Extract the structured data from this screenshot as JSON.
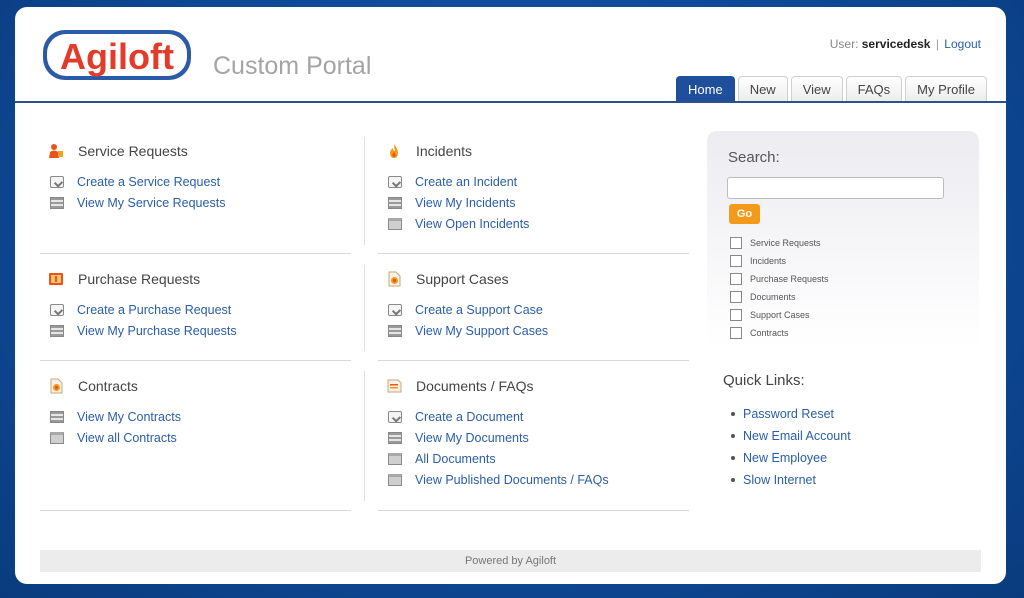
{
  "header": {
    "logo_text": "Agiloft",
    "portal_title": "Custom Portal",
    "user_label": "User:",
    "username": "servicedesk",
    "separator": "|",
    "logout": "Logout"
  },
  "tabs": [
    {
      "label": "Home",
      "active": true
    },
    {
      "label": "New"
    },
    {
      "label": "View"
    },
    {
      "label": "FAQs"
    },
    {
      "label": "My Profile"
    }
  ],
  "sections": {
    "service_requests": {
      "title": "Service Requests",
      "links": [
        "Create a Service Request",
        "View My Service Requests"
      ]
    },
    "incidents": {
      "title": "Incidents",
      "links": [
        "Create an Incident",
        "View My Incidents",
        "View Open Incidents"
      ]
    },
    "purchase_requests": {
      "title": "Purchase Requests",
      "links": [
        "Create a Purchase Request",
        "View My Purchase Requests"
      ]
    },
    "support_cases": {
      "title": "Support Cases",
      "links": [
        "Create a Support Case",
        "View My Support Cases"
      ]
    },
    "contracts": {
      "title": "Contracts",
      "links": [
        "View My Contracts",
        "View all Contracts"
      ]
    },
    "documents": {
      "title": "Documents / FAQs",
      "links": [
        "Create a Document",
        "View My Documents",
        "All Documents",
        "View Published Documents / FAQs"
      ]
    }
  },
  "search": {
    "label": "Search:",
    "value": "",
    "go": "Go",
    "filters": [
      "Service Requests",
      "Incidents",
      "Purchase Requests",
      "Documents",
      "Support Cases",
      "Contracts"
    ]
  },
  "quick_links": {
    "title": "Quick Links:",
    "items": [
      "Password Reset",
      "New Email Account",
      "New Employee",
      "Slow Internet"
    ]
  },
  "footer": {
    "text": "Powered by Agiloft"
  },
  "colors": {
    "brand_blue": "#1f4f9a",
    "link": "#2a5ea8",
    "go_button": "#f39a1a",
    "logo_red": "#e23b2a"
  }
}
